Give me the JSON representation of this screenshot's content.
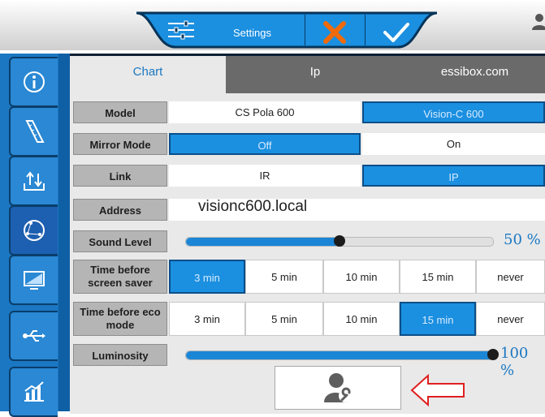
{
  "toolbar": {
    "settings_label": "Settings"
  },
  "tabs": [
    {
      "label": "Chart",
      "active": true
    },
    {
      "label": "Ip",
      "active": false
    },
    {
      "label": "essibox.com",
      "active": false
    }
  ],
  "model": {
    "label": "Model",
    "options": [
      "CS Pola 600",
      "Vision-C 600"
    ],
    "selected": "Vision-C 600"
  },
  "mirror": {
    "label": "Mirror Mode",
    "options": [
      "Off",
      "On"
    ],
    "selected": "Off"
  },
  "link": {
    "label": "Link",
    "options": [
      "IR",
      "IP"
    ],
    "selected": "IP"
  },
  "address": {
    "label": "Address",
    "value": "visionc600.local"
  },
  "sound": {
    "label": "Sound Level",
    "value_text": "50 %",
    "value": 0.5
  },
  "screen_saver": {
    "label": "Time before screen saver",
    "options": [
      "3 min",
      "5 min",
      "10 min",
      "15 min",
      "never"
    ],
    "selected": "3 min"
  },
  "eco": {
    "label": "Time before eco mode",
    "options": [
      "3 min",
      "5 min",
      "10 min",
      "15 min",
      "never"
    ],
    "selected": "15 min"
  },
  "luminosity": {
    "label": "Luminosity",
    "value_text": "100 %",
    "value": 1.0
  },
  "sidebar": {
    "items": [
      {
        "icon": "info-icon"
      },
      {
        "icon": "ruler-icon"
      },
      {
        "icon": "transfer-icon"
      },
      {
        "icon": "network-icon"
      },
      {
        "icon": "monitor-icon"
      },
      {
        "icon": "usb-icon"
      },
      {
        "icon": "chart-icon"
      }
    ]
  },
  "colors": {
    "accent": "#1b77c2",
    "selected": "#1b8fe0",
    "arrow": "#e02020"
  }
}
